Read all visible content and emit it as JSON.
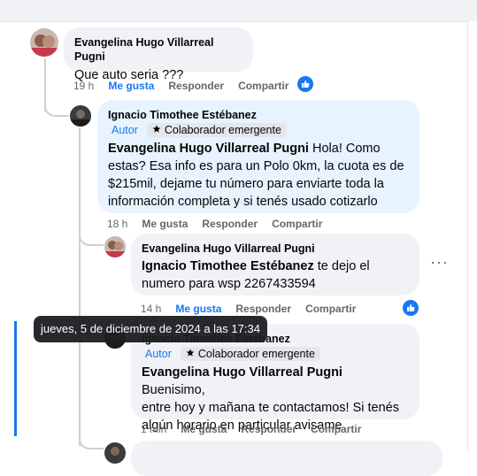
{
  "comments": [
    {
      "author": "Evangelina Hugo Villarreal Pugni",
      "text": "Que auto seria ???",
      "actions": {
        "time": "19 h",
        "like": "Me gusta",
        "reply": "Responder",
        "share": "Compartir"
      }
    },
    {
      "author": "Ignacio Timothee Estébanez",
      "badges": {
        "autor": "Autor",
        "colab": "Colaborador emergente"
      },
      "mention": "Evangelina Hugo Villarreal Pugni",
      "text_lines": [
        "Hola! Como",
        "estas? Esa info es para un Polo 0km, la cuota es de",
        "$215mil, dejame tu número para enviarte toda la",
        "información completa y si tenés usado cotizarlo"
      ],
      "actions": {
        "time": "18 h",
        "like": "Me gusta",
        "reply": "Responder",
        "share": "Compartir"
      }
    },
    {
      "author": "Evangelina Hugo Villarreal Pugni",
      "mention": "Ignacio Timothee Estébanez",
      "text_lines": [
        "te dejo el",
        "numero para wsp 2267433594"
      ],
      "actions": {
        "time": "14 h",
        "like": "Me gusta",
        "reply": "Responder",
        "share": "Compartir"
      }
    },
    {
      "author": "Ignacio Timothee Estébanez",
      "badges": {
        "autor": "Autor",
        "colab": "Colaborador emergente"
      },
      "mention": "Evangelina Hugo Villarreal Pugni",
      "text_lines": [
        "Buenisimo,",
        "entre hoy y mañana te contactamos! Si tenés",
        "algún horario en particular avisame"
      ],
      "actions": {
        "time": "1 min",
        "like": "Me gusta",
        "reply": "Responder",
        "share": "Compartir"
      }
    }
  ],
  "tooltip": "jueves, 5 de diciembre de 2024 a las 17:34",
  "colors": {
    "accent": "#1877f2",
    "bubble": "#f0f2f5",
    "bubble_highlight": "#e7f3ff",
    "muted": "#65676b"
  },
  "icons": [
    "like-reaction-icon",
    "more-options-icon",
    "star-icon"
  ]
}
